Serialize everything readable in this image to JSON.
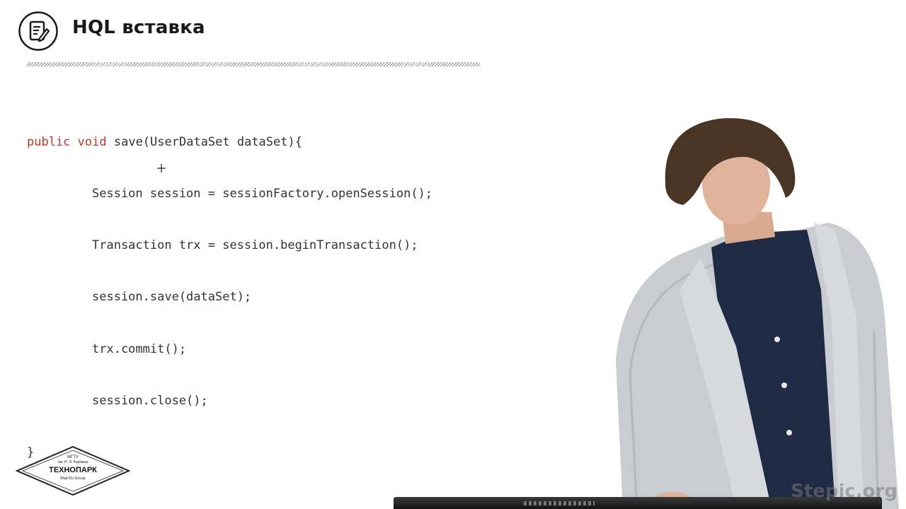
{
  "slide": {
    "icon": "notepad-pencil-icon",
    "title": "HQL вставка"
  },
  "code": {
    "line1": {
      "kw1": "public",
      "kw2": "void",
      "rest": " save(UserDataSet dataSet){"
    },
    "line2": "Session session = sessionFactory.openSession();",
    "line3": "Transaction trx = session.beginTransaction();",
    "line4": "session.save(dataSet);",
    "line5": "trx.commit();",
    "line6": "session.close();",
    "line7": "}"
  },
  "logo": {
    "line1": "МГТУ",
    "line2": "им. Н. Э. Баумана",
    "line3": "ТЕХНОПАРК",
    "line4": "Mail.Ru Group"
  },
  "watermark": "Stepic.org",
  "colors": {
    "keyword": "#c0392b",
    "code_text": "#333333",
    "title": "#1a1a1a"
  }
}
